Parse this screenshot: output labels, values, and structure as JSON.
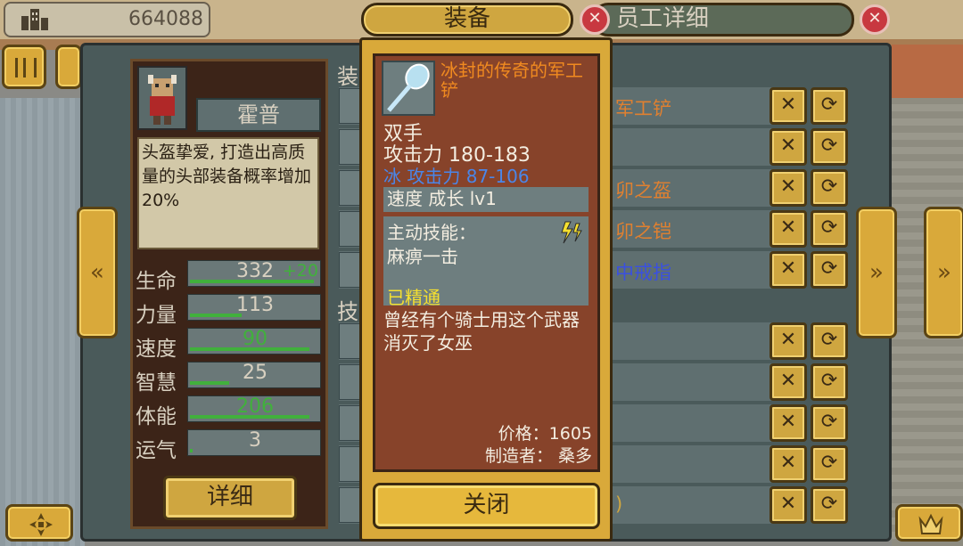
{
  "hud": {
    "money": "664088",
    "icons": [
      "building-icon",
      "pause-icon",
      "compass-icon",
      "crown-icon"
    ]
  },
  "tabs": {
    "equip": "装备",
    "staff_detail": "员工详细"
  },
  "character": {
    "name": "霍普",
    "description": "头盔挚爱, 打造出高质量的头部装备概率增加20%",
    "stats": [
      {
        "label": "生命",
        "value": "332",
        "bonus": "+20",
        "value_color": "#d8d0c0",
        "fill": 0.95
      },
      {
        "label": "力量",
        "value": "113",
        "bonus": "",
        "value_color": "#d8d0c0",
        "fill": 0.4
      },
      {
        "label": "速度",
        "value": "90",
        "bonus": "",
        "value_color": "#41b03c",
        "fill": 0.92
      },
      {
        "label": "智慧",
        "value": "25",
        "bonus": "",
        "value_color": "#d8d0c0",
        "fill": 0.3
      },
      {
        "label": "体能",
        "value": "206",
        "bonus": "",
        "value_color": "#41b03c",
        "fill": 0.92
      },
      {
        "label": "运气",
        "value": "3",
        "bonus": "",
        "value_color": "#d8d0c0",
        "fill": 0.02
      }
    ],
    "detail_button": "详细"
  },
  "lists": {
    "equip_label": "装",
    "skill_label": "技",
    "equip_rows": [
      {
        "text": "军工铲",
        "color": "#e08030"
      },
      {
        "text": "",
        "color": "#d8d0c0"
      },
      {
        "text": "卯之盔",
        "color": "#e08030"
      },
      {
        "text": "卯之铠",
        "color": "#e08030"
      },
      {
        "text": "中戒指",
        "color": "#3a50e0"
      }
    ],
    "skill_rows": [
      "",
      "",
      "",
      "",
      ")"
    ]
  },
  "item": {
    "name": "冰封的传奇的军工铲",
    "hand": "双手",
    "attack": "攻击力 180-183",
    "ice_attack": "冰 攻击力 87-106",
    "speed": "速度 成长 lv1",
    "skill_title": "主动技能：",
    "skill_name": "麻痹一击",
    "skill_mastery": "已精通",
    "flavor": "曾经有个骑士用这个武器消灭了女巫",
    "price": "价格：1605",
    "maker": "制造者：  桑多",
    "close_button": "关闭"
  },
  "colors": {
    "gold": "#d9a93a",
    "item_name": "#f08a20",
    "ice": "#4a86e8",
    "mastery": "#f5e030"
  }
}
